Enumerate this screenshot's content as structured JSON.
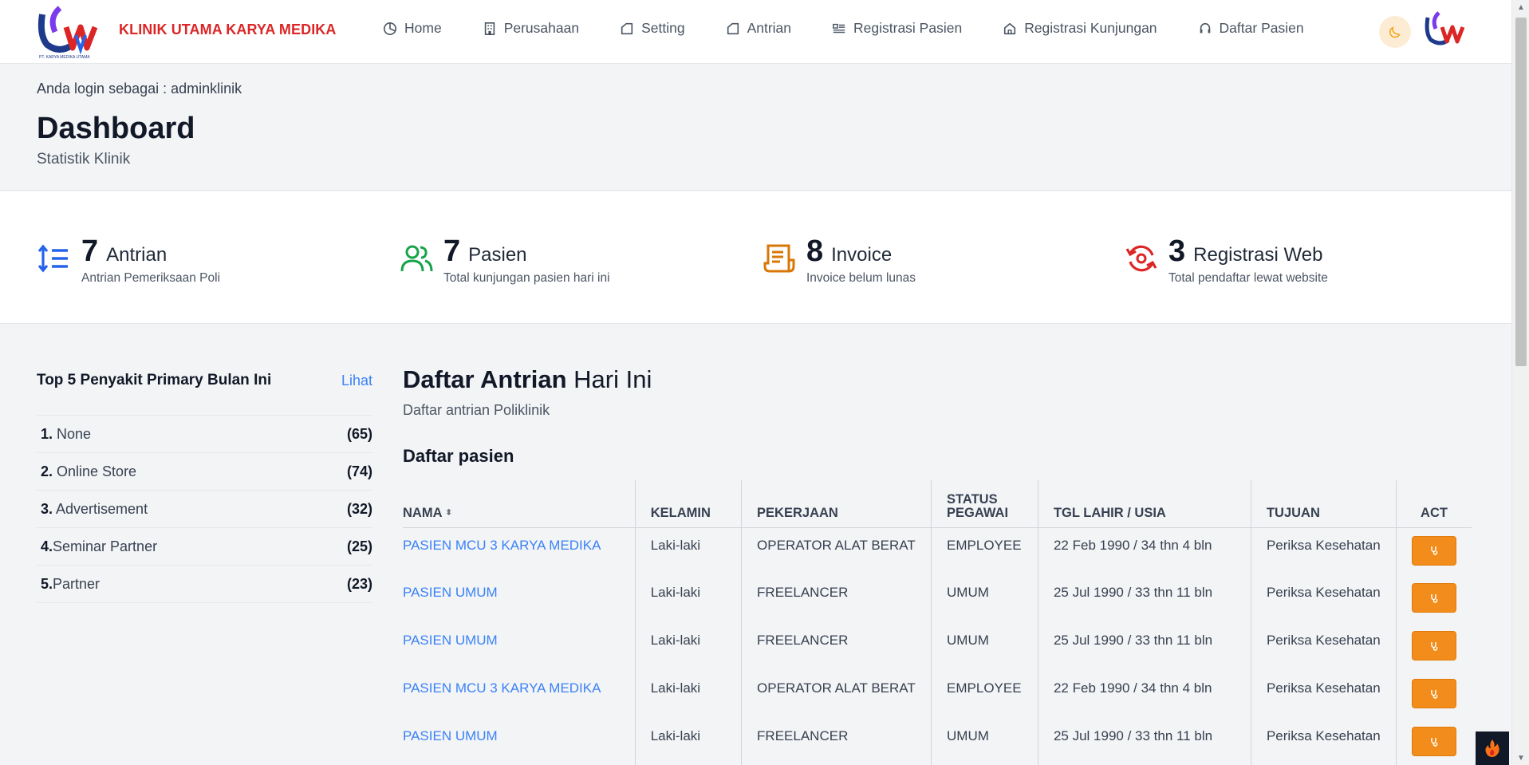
{
  "brand": {
    "name": "KLINIK UTAMA KARYA MEDIKA",
    "logo_caption": "PT. KARYA MEDIKA UTAMA"
  },
  "nav": {
    "items": [
      {
        "label": "Home",
        "icon": "clock-pie-icon"
      },
      {
        "label": "Perusahaan",
        "icon": "building-icon"
      },
      {
        "label": "Setting",
        "icon": "tag-icon"
      },
      {
        "label": "Antrian",
        "icon": "tag-icon"
      },
      {
        "label": "Registrasi Pasien",
        "icon": "list-icon"
      },
      {
        "label": "Registrasi Kunjungan",
        "icon": "home-icon"
      },
      {
        "label": "Daftar Pasien",
        "icon": "headset-icon"
      }
    ]
  },
  "header": {
    "login_info": "Anda login sebagai : adminklinik",
    "title": "Dashboard",
    "subtitle": "Statistik Klinik"
  },
  "stats": [
    {
      "value": "7",
      "label": "Antrian",
      "desc": "Antrian Pemeriksaan Poli",
      "icon": "sort-list-icon",
      "color": "#2563eb"
    },
    {
      "value": "7",
      "label": "Pasien",
      "desc": "Total kunjungan pasien hari ini",
      "icon": "users-icon",
      "color": "#16a34a"
    },
    {
      "value": "8",
      "label": "Invoice",
      "desc": "Invoice belum lunas",
      "icon": "receipt-icon",
      "color": "#d97706"
    },
    {
      "value": "3",
      "label": "Registrasi Web",
      "desc": "Total pendaftar lewat website",
      "icon": "refresh-icon",
      "color": "#dc2626"
    }
  ],
  "top_diseases": {
    "title": "Top 5 Penyakit Primary Bulan Ini",
    "link": "Lihat",
    "items": [
      {
        "rank": "1.",
        "name": " None",
        "count": "(65)"
      },
      {
        "rank": "2.",
        "name": " Online Store",
        "count": "(74)"
      },
      {
        "rank": "3.",
        "name": " Advertisement",
        "count": "(32)"
      },
      {
        "rank": "4.",
        "name": "Seminar Partner",
        "count": "(25)"
      },
      {
        "rank": "5.",
        "name": "Partner",
        "count": "(23)"
      }
    ]
  },
  "queue": {
    "title_bold": "Daftar Antrian",
    "title_rest": " Hari Ini",
    "subtitle": "Daftar antrian Poliklinik",
    "list_title": "Daftar pasien",
    "columns": [
      "NAMA",
      "KELAMIN",
      "PEKERJAAN",
      "STATUS PEGAWAI",
      "TGL LAHIR / USIA",
      "TUJUAN",
      "ACT"
    ],
    "rows": [
      {
        "nama": "PASIEN MCU 3 KARYA MEDIKA",
        "kelamin": "Laki-laki",
        "pekerjaan": "OPERATOR ALAT BERAT",
        "status": "EMPLOYEE",
        "tgl": "22 Feb 1990 / 34 thn 4 bln",
        "tujuan": "Periksa Kesehatan"
      },
      {
        "nama": "PASIEN UMUM",
        "kelamin": "Laki-laki",
        "pekerjaan": "FREELANCER",
        "status": "UMUM",
        "tgl": "25 Jul 1990 / 33 thn 11 bln",
        "tujuan": "Periksa Kesehatan"
      },
      {
        "nama": "PASIEN UMUM",
        "kelamin": "Laki-laki",
        "pekerjaan": "FREELANCER",
        "status": "UMUM",
        "tgl": "25 Jul 1990 / 33 thn 11 bln",
        "tujuan": "Periksa Kesehatan"
      },
      {
        "nama": "PASIEN MCU 3 KARYA MEDIKA",
        "kelamin": "Laki-laki",
        "pekerjaan": "OPERATOR ALAT BERAT",
        "status": "EMPLOYEE",
        "tgl": "22 Feb 1990 / 34 thn 4 bln",
        "tujuan": "Periksa Kesehatan"
      },
      {
        "nama": "PASIEN UMUM",
        "kelamin": "Laki-laki",
        "pekerjaan": "FREELANCER",
        "status": "UMUM",
        "tgl": "25 Jul 1990 / 33 thn 11 bln",
        "tujuan": "Periksa Kesehatan"
      }
    ]
  },
  "colors": {
    "brand_red": "#dc2626",
    "link_blue": "#3b82f6",
    "action_orange": "#f28c1b"
  }
}
